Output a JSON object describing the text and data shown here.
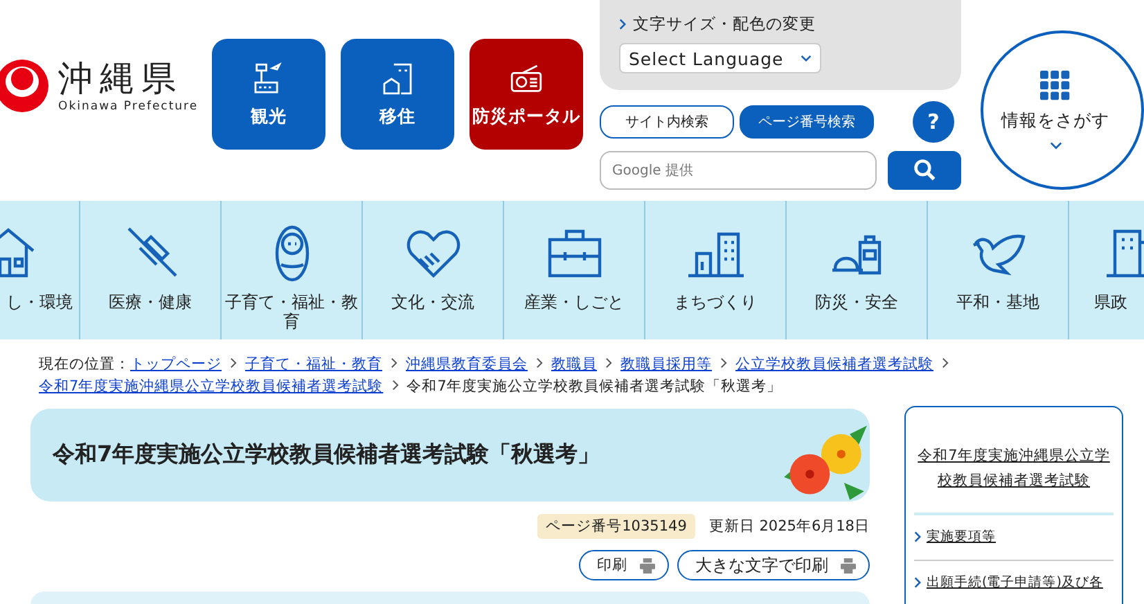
{
  "header": {
    "logo": {
      "name": "沖縄県",
      "romaji": "Okinawa Prefecture"
    },
    "quick_links": [
      {
        "label": "観光",
        "kind": "tourism"
      },
      {
        "label": "移住",
        "kind": "migration"
      },
      {
        "label": "防災ポータル",
        "kind": "disaster"
      }
    ],
    "text_size_link": "文字サイズ・配色の変更",
    "language_select": {
      "value": "Select Language"
    },
    "search_tabs": [
      {
        "label": "サイト内検索",
        "selected": true
      },
      {
        "label": "ページ番号検索",
        "selected": false
      }
    ],
    "search_field": {
      "placeholder": "Google 提供"
    },
    "help_button": "?",
    "info_button": "情報をさがす"
  },
  "nav": [
    {
      "label": "し・環境",
      "kind": "house"
    },
    {
      "label": "医療・健康",
      "kind": "syringe"
    },
    {
      "label": "子育て・福祉・教育",
      "kind": "baby"
    },
    {
      "label": "文化・交流",
      "kind": "heart"
    },
    {
      "label": "産業・しごと",
      "kind": "briefcase"
    },
    {
      "label": "まちづくり",
      "kind": "town"
    },
    {
      "label": "防災・安全",
      "kind": "helmet"
    },
    {
      "label": "平和・基地",
      "kind": "dove"
    },
    {
      "label": "県政",
      "kind": "building"
    }
  ],
  "breadcrumb": {
    "label": "現在の位置：",
    "items": [
      {
        "label": "トップページ",
        "link": true
      },
      {
        "label": "子育て・福祉・教育",
        "link": true
      },
      {
        "label": "沖縄県教育委員会",
        "link": true
      },
      {
        "label": "教職員",
        "link": true
      },
      {
        "label": "教職員採用等",
        "link": true
      },
      {
        "label": "公立学校教員候補者選考試験",
        "link": true
      },
      {
        "label": "令和7年度実施沖縄県公立学校教員候補者選考試験",
        "link": true
      },
      {
        "label": "令和7年度実施公立学校教員候補者選考試験「秋選考」",
        "link": false
      }
    ]
  },
  "page": {
    "title": "令和7年度実施公立学校教員候補者選考試験「秋選考」",
    "page_number": "ページ番号1035149",
    "updated": "更新日 2025年6月18日",
    "print_buttons": [
      "印刷",
      "大きな文字で印刷"
    ]
  },
  "sidebar": {
    "heading": "令和7年度実施沖縄県公立学校教員候補者選考試験",
    "items": [
      "実施要項等",
      "出願手続(電子申請等)及び各"
    ]
  }
}
